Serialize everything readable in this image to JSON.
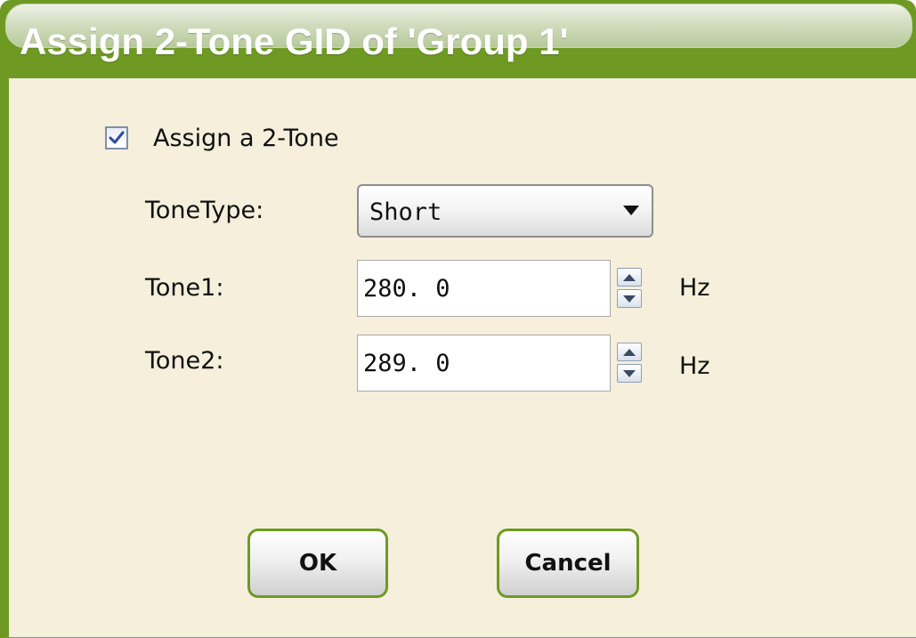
{
  "dialog": {
    "title": "Assign 2-Tone GID of 'Group 1'"
  },
  "assign_checkbox": {
    "label": "Assign a 2-Tone",
    "checked": true
  },
  "tone_type": {
    "label": "ToneType:",
    "selected": "Short"
  },
  "tone1": {
    "label": "Tone1:",
    "value": "280. 0",
    "unit": "Hz"
  },
  "tone2": {
    "label": "Tone2:",
    "value": "289. 0",
    "unit": "Hz"
  },
  "buttons": {
    "ok": "OK",
    "cancel": "Cancel"
  },
  "colors": {
    "title_bar": "#6e9a23",
    "body_background": "#f6efdc",
    "button_border": "#6e9a23"
  },
  "icons": {
    "checkbox_check": "check-icon",
    "dropdown": "dropdown-arrow-icon",
    "spin_up": "spin-up-icon",
    "spin_down": "spin-down-icon"
  }
}
